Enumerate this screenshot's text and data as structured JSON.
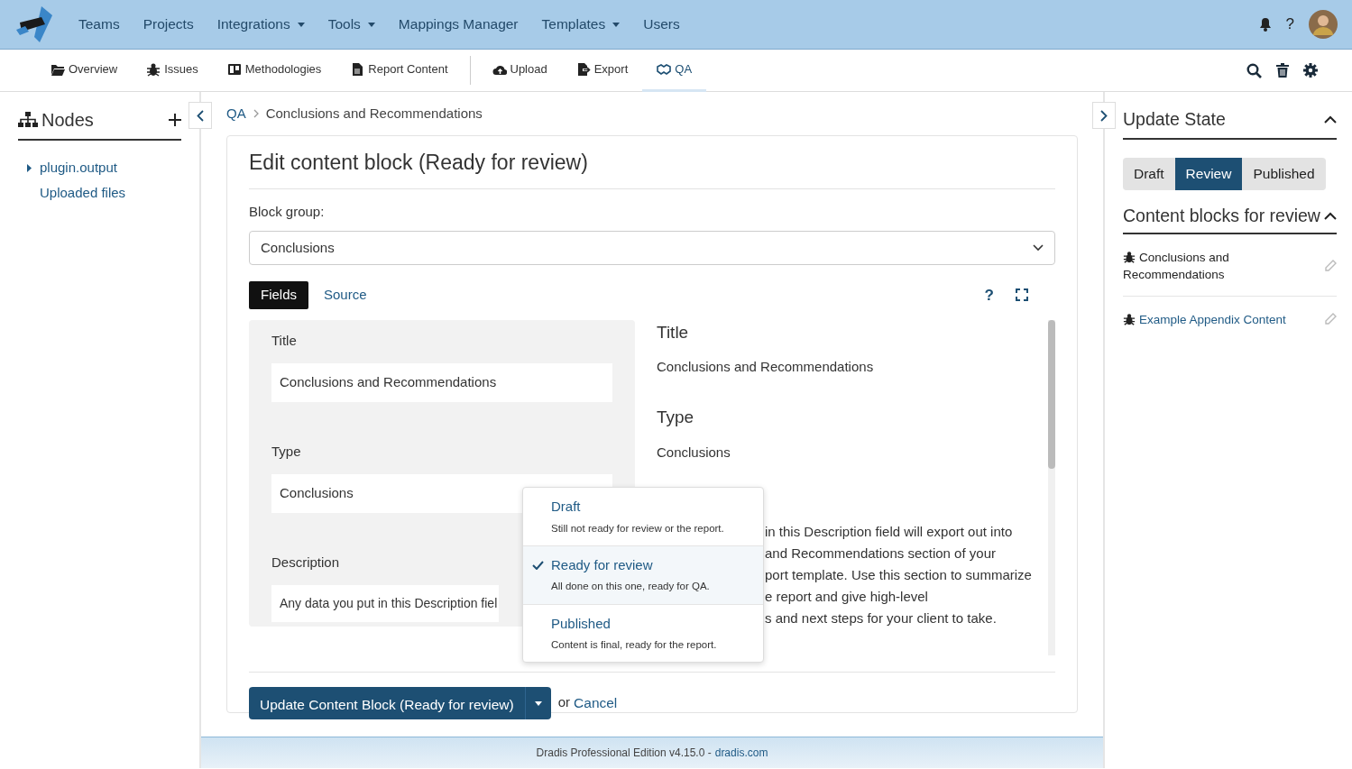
{
  "navbar": {
    "items": [
      {
        "label": "Teams",
        "dropdown": false
      },
      {
        "label": "Projects",
        "dropdown": false
      },
      {
        "label": "Integrations",
        "dropdown": true
      },
      {
        "label": "Tools",
        "dropdown": true
      },
      {
        "label": "Mappings Manager",
        "dropdown": false
      },
      {
        "label": "Templates",
        "dropdown": true
      },
      {
        "label": "Users",
        "dropdown": false
      }
    ],
    "help": "?"
  },
  "subnav": {
    "items": [
      {
        "label": "Overview",
        "selected": false
      },
      {
        "label": "Issues",
        "selected": false
      },
      {
        "label": "Methodologies",
        "selected": false
      },
      {
        "label": "Report Content",
        "selected": false
      },
      {
        "label": "Upload",
        "selected": false
      },
      {
        "label": "Export",
        "selected": false
      },
      {
        "label": "QA",
        "selected": true
      }
    ]
  },
  "sidebar": {
    "title": "Nodes",
    "items": [
      {
        "label": "plugin.output",
        "expandable": true
      },
      {
        "label": "Uploaded files",
        "expandable": false
      }
    ]
  },
  "breadcrumb": [
    "QA",
    "Conclusions and Recommendations"
  ],
  "editor": {
    "heading": "Edit content block (Ready for review)",
    "group_label": "Block group:",
    "group_value": "Conclusions",
    "tabs": [
      {
        "label": "Fields",
        "selected": true
      },
      {
        "label": "Source",
        "selected": false
      }
    ],
    "fields": [
      {
        "label": "Title",
        "value": "Conclusions and Recommendations"
      },
      {
        "label": "Type",
        "value": "Conclusions"
      },
      {
        "label": "Description",
        "value": "Any data you put in this Description fiel"
      }
    ],
    "preview": [
      {
        "heading": "Title",
        "lines": [
          "Conclusions and Recommendations"
        ]
      },
      {
        "heading": "Type",
        "lines": [
          "Conclusions"
        ]
      },
      {
        "lines": [
          "in this Description field will export out into",
          "and Recommendations section of your",
          "port template. Use this section to summarize",
          "e report and give high-level",
          "s and next steps for your client to take."
        ]
      }
    ],
    "states": [
      {
        "title": "Draft",
        "note": "Still not ready for review or the report.",
        "selected": false
      },
      {
        "title": "Ready for review",
        "note": "All done on this one, ready for QA.",
        "selected": true
      },
      {
        "title": "Published",
        "note": "Content is final, ready for the report.",
        "selected": false
      }
    ],
    "submit": "Update Content Block (Ready for review)",
    "or": "or",
    "cancel": "Cancel"
  },
  "right": {
    "title": "Update State",
    "states": [
      {
        "label": "Draft",
        "selected": false
      },
      {
        "label": "Review",
        "selected": true
      },
      {
        "label": "Published",
        "selected": false
      }
    ],
    "list_title": "Content blocks for review",
    "blocks": [
      {
        "label": "Conclusions and Recommendations",
        "current": true
      },
      {
        "label": "Example Appendix Content",
        "current": false
      }
    ]
  },
  "footer": {
    "text": "Dradis Professional Edition v4.15.0 -",
    "link": "dradis.com"
  }
}
